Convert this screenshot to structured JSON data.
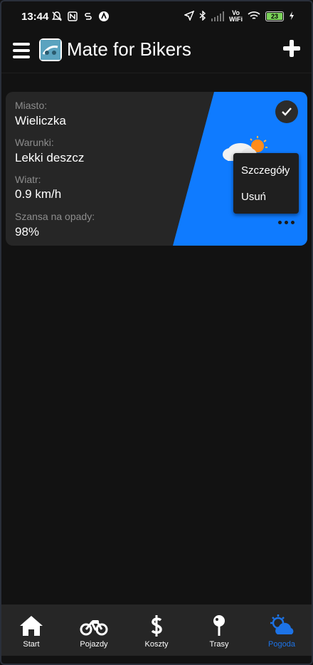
{
  "status_bar": {
    "time": "13:44",
    "battery": "23",
    "network_label_top": "Vo",
    "network_label_bottom": "WiFi"
  },
  "app_bar": {
    "title": "Mate for Bikers"
  },
  "weather_card": {
    "city_label": "Miasto:",
    "city_value": "Wieliczka",
    "conditions_label": "Warunki:",
    "conditions_value": "Lekki deszcz",
    "wind_label": "Wiatr:",
    "wind_value": "0.9 km/h",
    "rain_chance_label": "Szansa na opady:",
    "rain_chance_value": "98%",
    "accent_color": "#0f7bff"
  },
  "context_menu": {
    "items": [
      "Szczegóły",
      "Usuń"
    ]
  },
  "bottom_nav": {
    "items": [
      {
        "label": "Start",
        "icon": "home-icon"
      },
      {
        "label": "Pojazdy",
        "icon": "motorcycle-icon"
      },
      {
        "label": "Koszty",
        "icon": "dollar-icon"
      },
      {
        "label": "Trasy",
        "icon": "map-pin-icon"
      },
      {
        "label": "Pogoda",
        "icon": "weather-icon"
      }
    ],
    "active": "Pogoda",
    "active_color": "#1d73e6"
  }
}
